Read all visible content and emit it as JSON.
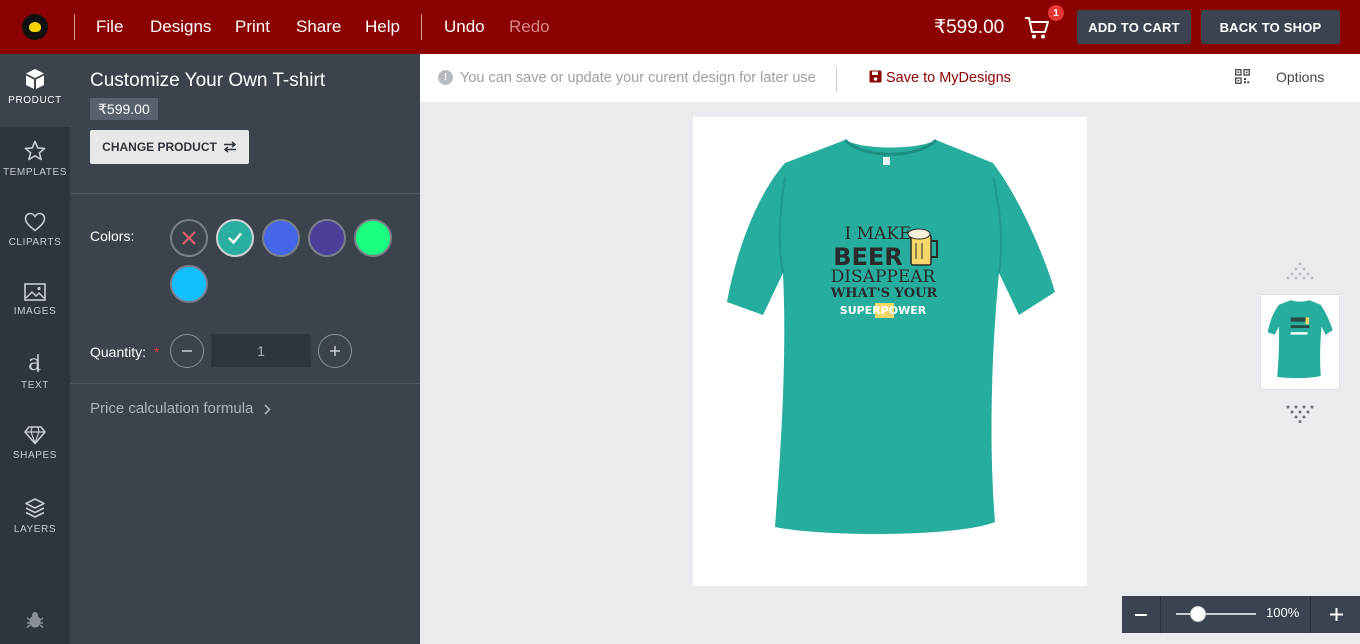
{
  "topbar": {
    "menu": [
      "File",
      "Designs",
      "Print",
      "Share",
      "Help"
    ],
    "undo_label": "Undo",
    "redo_label": "Redo",
    "price": "₹599.00",
    "cart_count": "1",
    "add_to_cart_label": "ADD TO CART",
    "back_to_shop_label": "BACK TO SHOP"
  },
  "nav": {
    "items": [
      {
        "label": "PRODUCT",
        "icon": "cube-icon"
      },
      {
        "label": "TEMPLATES",
        "icon": "star-icon"
      },
      {
        "label": "CLIPARTS",
        "icon": "heart-icon"
      },
      {
        "label": "IMAGES",
        "icon": "image-icon"
      },
      {
        "label": "TEXT",
        "icon": "text-icon"
      },
      {
        "label": "SHAPES",
        "icon": "diamond-icon"
      },
      {
        "label": "LAYERS",
        "icon": "layers-icon"
      }
    ],
    "bottom_icon": "bug-icon"
  },
  "panel": {
    "title": "Customize Your Own T-shirt",
    "price": "₹599.00",
    "change_product_label": "CHANGE PRODUCT",
    "colors_label": "Colors:",
    "colors": [
      "#3c434d",
      "#2aaea0",
      "#4466e8",
      "#4b3f9a",
      "#1aff80",
      "#14bfff"
    ],
    "selected_color_index": 1,
    "quantity_label": "Quantity:",
    "required_mark": "*",
    "quantity_value": "1",
    "formula_label": "Price calculation formula"
  },
  "infobar": {
    "message": "You can save or update your curent design for later use",
    "save_label": "Save to MyDesigns",
    "options_label": "Options"
  },
  "design": {
    "shirt_color": "#26ad9e",
    "lines": [
      "I MAKE",
      "BEER",
      "DISAPPEAR",
      "WHAT'S YOUR",
      "SUPERPOWER"
    ]
  },
  "zoom": {
    "level": "100%",
    "slider_fraction": 0.28
  },
  "colors": {
    "brand": "#8b0000",
    "nav_bg": "#2f353d",
    "panel_bg": "#3c434d"
  }
}
